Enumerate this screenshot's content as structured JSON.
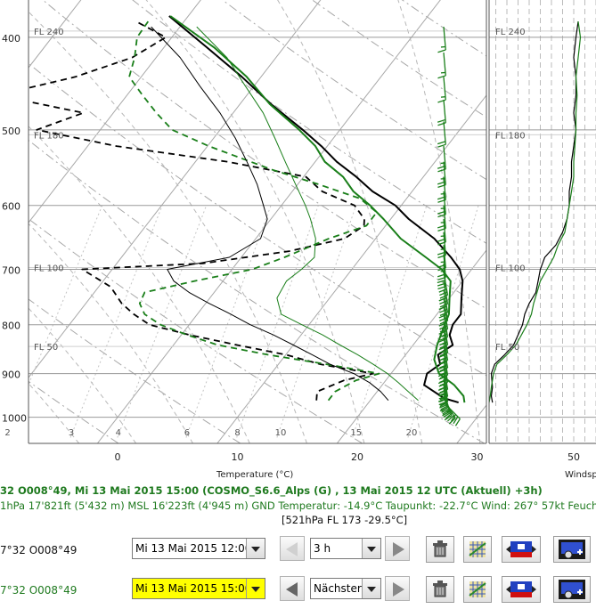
{
  "chart_data": {
    "type": "line",
    "title": "",
    "xlabel": "Temperature (°C)",
    "ylabel": "",
    "pressure_ticks": [
      400,
      500,
      600,
      700,
      800,
      900,
      1000
    ],
    "x_ticks": [
      0,
      10,
      20,
      30
    ],
    "xlim": [
      -7.7,
      32.3
    ],
    "ylim_hpa": [
      1065,
      380
    ],
    "mixing_ratio_labels": [
      "2",
      "3",
      "4",
      "6",
      "8",
      "10",
      "15",
      "20"
    ],
    "mixing_ratio_values": [
      2,
      3,
      4,
      6,
      8,
      10,
      15,
      20
    ],
    "flight_levels": [
      "FL 240",
      "FL 180",
      "FL 100",
      "FL 50"
    ],
    "flight_level_hpa": [
      394,
      506,
      697,
      843
    ],
    "grid": true,
    "series": [
      {
        "style": "solid-bold",
        "color": "#000000",
        "p": [
          965,
          955,
          925,
          900,
          880,
          860,
          840,
          820,
          800,
          780,
          750,
          720,
          700,
          680,
          650,
          620,
          600,
          580,
          560,
          540,
          520,
          500,
          470,
          440,
          410,
          380
        ],
        "t": [
          27.5,
          26.0,
          23.5,
          23.0,
          23.5,
          22.7,
          23.3,
          22.4,
          22.0,
          22.0,
          21.0,
          20.0,
          19.0,
          17.5,
          14.9,
          11.5,
          9.5,
          6.7,
          4.4,
          1.8,
          -0.5,
          -3.1,
          -7.4,
          -11.6,
          -16.4,
          -21.6
        ]
      },
      {
        "style": "solid-bold",
        "color": "#1a7f1a",
        "p": [
          965,
          950,
          925,
          900,
          870,
          840,
          810,
          780,
          750,
          720,
          700,
          680,
          650,
          620,
          600,
          580,
          560,
          540,
          520,
          500,
          470,
          440,
          410,
          380
        ],
        "t": [
          28.0,
          27.5,
          26.0,
          24.0,
          22.7,
          22.0,
          21.5,
          21.0,
          20.0,
          19.0,
          17.5,
          15.4,
          12.1,
          9.4,
          7.4,
          5.1,
          3.3,
          0.8,
          -1.0,
          -3.4,
          -7.5,
          -11.2,
          -15.8,
          -21.5
        ]
      },
      {
        "style": "dashed",
        "color": "#000000",
        "p": [
          960,
          940,
          915,
          900,
          880,
          860,
          840,
          820,
          800,
          780,
          760,
          730,
          700,
          690,
          670,
          650,
          630,
          620,
          600,
          580,
          560,
          540,
          520,
          500,
          480,
          460,
          440,
          420,
          400,
          385
        ],
        "t": [
          15.5,
          15.0,
          16.5,
          18.5,
          13.5,
          10.0,
          5.3,
          0.7,
          -3.3,
          -5.3,
          -7.0,
          -9.0,
          -12.5,
          -2.8,
          3.6,
          7.4,
          8.2,
          7.8,
          6.1,
          2.5,
          0.2,
          -7.3,
          -17.6,
          -25.3,
          -22.5,
          -30.8,
          -25.5,
          -22.0,
          -20.5,
          -24.0
        ]
      },
      {
        "style": "dashed",
        "color": "#1a7f1a",
        "p": [
          960,
          940,
          915,
          900,
          880,
          860,
          840,
          820,
          800,
          780,
          760,
          740,
          720,
          700,
          680,
          650,
          630,
          610,
          590,
          570,
          550,
          520,
          500,
          480,
          460,
          440,
          420,
          400,
          385
        ],
        "t": [
          16.5,
          16.5,
          17.5,
          19.0,
          14.0,
          8.5,
          3.7,
          0.5,
          -2.4,
          -4.4,
          -5.5,
          -5.8,
          -2.4,
          1.7,
          3.6,
          6.1,
          8.4,
          8.4,
          6.1,
          1.7,
          -3.2,
          -9.9,
          -14.0,
          -16.4,
          -18.7,
          -21.0,
          -21.8,
          -22.9,
          -23.0
        ]
      },
      {
        "style": "solid-thin",
        "color": "#000000",
        "p": [
          960,
          940,
          920,
          900,
          880,
          860,
          840,
          820,
          800,
          780,
          760,
          740,
          720,
          700,
          680,
          650,
          620,
          600,
          570,
          540,
          510,
          480,
          450,
          420,
          390
        ],
        "t": [
          21.5,
          20.3,
          18.8,
          16.9,
          14.3,
          12.2,
          10.0,
          7.7,
          5.1,
          2.8,
          0.3,
          -2.1,
          -4.1,
          -5.4,
          -1.0,
          0.4,
          -0.3,
          -1.5,
          -3.4,
          -5.7,
          -8.2,
          -11.1,
          -14.5,
          -18.0,
          -22.4
        ]
      },
      {
        "style": "solid-thin",
        "color": "#1a7f1a",
        "p": [
          960,
          940,
          920,
          900,
          880,
          860,
          840,
          820,
          800,
          780,
          750,
          720,
          700,
          680,
          650,
          620,
          600,
          570,
          540,
          510,
          480,
          450,
          420,
          390
        ],
        "t": [
          24.0,
          22.6,
          21.2,
          19.7,
          17.9,
          16.0,
          13.9,
          11.8,
          9.4,
          7.0,
          5.6,
          5.3,
          5.8,
          6.1,
          5.0,
          3.3,
          2.0,
          -0.2,
          -2.5,
          -4.9,
          -7.5,
          -10.7,
          -14.1,
          -18.6
        ]
      }
    ],
    "wind_barbs": [
      {
        "p": 965,
        "speed_kt": 30,
        "dir": 315
      },
      {
        "p": 955,
        "speed_kt": 35,
        "dir": 330
      },
      {
        "p": 945,
        "speed_kt": 40,
        "dir": 340
      },
      {
        "p": 935,
        "speed_kt": 40,
        "dir": 345
      },
      {
        "p": 925,
        "speed_kt": 40,
        "dir": 350
      },
      {
        "p": 912,
        "speed_kt": 40,
        "dir": 350
      },
      {
        "p": 900,
        "speed_kt": 40,
        "dir": 350
      },
      {
        "p": 885,
        "speed_kt": 40,
        "dir": 350
      },
      {
        "p": 870,
        "speed_kt": 40,
        "dir": 350
      },
      {
        "p": 855,
        "speed_kt": 40,
        "dir": 350
      },
      {
        "p": 840,
        "speed_kt": 35,
        "dir": 350
      },
      {
        "p": 825,
        "speed_kt": 35,
        "dir": 350
      },
      {
        "p": 810,
        "speed_kt": 35,
        "dir": 350
      },
      {
        "p": 795,
        "speed_kt": 35,
        "dir": 350
      },
      {
        "p": 780,
        "speed_kt": 35,
        "dir": 350
      },
      {
        "p": 765,
        "speed_kt": 30,
        "dir": 350
      },
      {
        "p": 750,
        "speed_kt": 30,
        "dir": 350
      },
      {
        "p": 735,
        "speed_kt": 30,
        "dir": 350
      },
      {
        "p": 720,
        "speed_kt": 30,
        "dir": 350
      },
      {
        "p": 705,
        "speed_kt": 30,
        "dir": 350
      },
      {
        "p": 690,
        "speed_kt": 30,
        "dir": 355
      },
      {
        "p": 675,
        "speed_kt": 25,
        "dir": 355
      },
      {
        "p": 660,
        "speed_kt": 25,
        "dir": 355
      },
      {
        "p": 640,
        "speed_kt": 25,
        "dir": 355
      },
      {
        "p": 620,
        "speed_kt": 25,
        "dir": 355
      },
      {
        "p": 600,
        "speed_kt": 25,
        "dir": 355
      },
      {
        "p": 580,
        "speed_kt": 25,
        "dir": 355
      },
      {
        "p": 560,
        "speed_kt": 25,
        "dir": 355
      },
      {
        "p": 540,
        "speed_kt": 25,
        "dir": 355
      },
      {
        "p": 520,
        "speed_kt": 25,
        "dir": 355
      },
      {
        "p": 490,
        "speed_kt": 20,
        "dir": 355
      },
      {
        "p": 465,
        "speed_kt": 20,
        "dir": 355
      },
      {
        "p": 440,
        "speed_kt": 15,
        "dir": 355
      },
      {
        "p": 415,
        "speed_kt": 15,
        "dir": 355
      },
      {
        "p": 390,
        "speed_kt": 15,
        "dir": 355
      }
    ],
    "wind_panel": {
      "label": "Windsp",
      "x_ticks": [
        50
      ],
      "xlim": [
        12,
        60
      ],
      "flight_levels": [
        "FL 240",
        "FL 180",
        "FL 100",
        "FL 50"
      ],
      "series": [
        {
          "color": "#000000",
          "p": [
            965,
            950,
            930,
            900,
            880,
            860,
            840,
            820,
            800,
            780,
            760,
            740,
            720,
            700,
            690,
            680,
            660,
            640,
            620,
            600,
            580,
            560,
            540,
            520,
            500,
            480,
            460,
            440,
            420,
            400,
            385
          ],
          "speed": [
            13.5,
            13,
            13.5,
            13,
            14.5,
            19,
            23,
            25,
            27,
            28,
            30,
            33,
            34,
            35,
            36,
            37,
            42,
            45,
            47,
            48,
            48,
            49,
            49,
            50,
            51,
            50,
            51,
            51,
            50,
            51,
            52
          ]
        },
        {
          "color": "#1a7f1a",
          "p": [
            965,
            950,
            930,
            900,
            880,
            860,
            840,
            820,
            800,
            780,
            760,
            740,
            720,
            700,
            680,
            660,
            640,
            620,
            600,
            580,
            560,
            540,
            520,
            500,
            480,
            460,
            440,
            420,
            400,
            385
          ],
          "speed": [
            12,
            12.5,
            13,
            14,
            15.5,
            20,
            24,
            26.5,
            29,
            31,
            32,
            33.5,
            35,
            38,
            41,
            43,
            46,
            47,
            48,
            49,
            50,
            50,
            50.5,
            51,
            51,
            51.5,
            51,
            52,
            53,
            52
          ]
        }
      ]
    }
  },
  "info": {
    "line1": "32 O008°49, Mi 13 Mai 2015 15:00 (COSMO_S6.6_Alps (G) , 13 Mai 2015 12 UTC (Aktuell) +3h)",
    "line2": "1hPa   17'821ft (5'432 m) MSL   16'223ft (4'945 m) GND   Temperatur: -14.9°C   Taupunkt: -22.7°C   Wind: 267°   57kt   Feuch",
    "line3": "[521hPa   FL 173   -29.5°C]"
  },
  "row1": {
    "label": "7°32 O008°49",
    "date_value": "Mi 13 Mai 2015 12:00",
    "step_value": "3 h"
  },
  "row2": {
    "label": "7°32 O008°49",
    "date_value": "Mi 13 Mai 2015 15:00",
    "step_value": "Nächster"
  },
  "colors": {
    "green": "#1a7f1a",
    "grid": "#a8a8a8",
    "highlight": "#ffff00"
  }
}
